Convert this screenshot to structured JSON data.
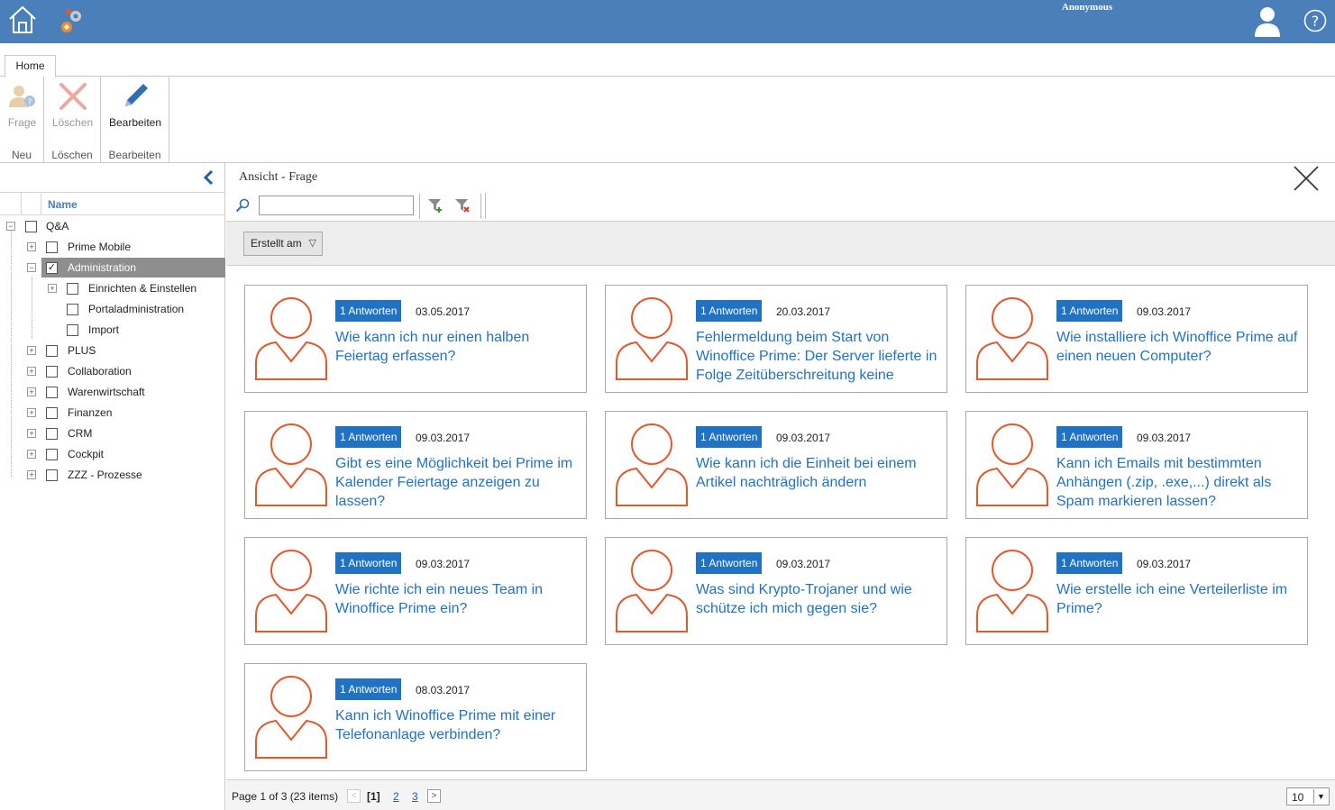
{
  "topbar": {
    "user_name": "Anonymous",
    "accent": "#4a7fba"
  },
  "ribbon": {
    "tab": "Home",
    "buttons": {
      "frage": "Frage",
      "loeschen": "Löschen",
      "bearbeiten": "Bearbeiten"
    },
    "groups": {
      "neu": "Neu",
      "loeschen": "Löschen",
      "bearbeiten": "Bearbeiten"
    }
  },
  "tree": {
    "header": "Name",
    "nodes": [
      {
        "label": "Q&A",
        "checked": false
      },
      {
        "label": "Prime Mobile",
        "checked": false
      },
      {
        "label": "Administration",
        "checked": true
      },
      {
        "label": "Einrichten & Einstellen",
        "checked": false
      },
      {
        "label": "Portaladministration",
        "checked": false
      },
      {
        "label": "Import",
        "checked": false
      },
      {
        "label": "PLUS",
        "checked": false
      },
      {
        "label": "Collaboration",
        "checked": false
      },
      {
        "label": "Warenwirtschaft",
        "checked": false
      },
      {
        "label": "Finanzen",
        "checked": false
      },
      {
        "label": "CRM",
        "checked": false
      },
      {
        "label": "Cockpit",
        "checked": false
      },
      {
        "label": "ZZZ - Prozesse",
        "checked": false
      }
    ]
  },
  "main": {
    "title": "Ansicht - Frage",
    "search": {
      "value": "",
      "placeholder": ""
    },
    "sort_button": "Erstellt am",
    "cards": [
      {
        "answers": "1 Antworten",
        "date": "03.05.2017",
        "question": "Wie kann ich nur einen halben Feiertag erfassen?"
      },
      {
        "answers": "1 Antworten",
        "date": "20.03.2017",
        "question": "Fehlermeldung beim Start von Winoffice Prime: Der Server lieferte in Folge Zeitüberschreitung keine"
      },
      {
        "answers": "1 Antworten",
        "date": "09.03.2017",
        "question": "Wie installiere ich Winoffice Prime auf einen neuen Computer?"
      },
      {
        "answers": "1 Antworten",
        "date": "09.03.2017",
        "question": "Gibt es eine Möglichkeit bei Prime im Kalender Feiertage anzeigen zu lassen?"
      },
      {
        "answers": "1 Antworten",
        "date": "09.03.2017",
        "question": "Wie kann ich die Einheit bei einem Artikel nachträglich ändern"
      },
      {
        "answers": "1 Antworten",
        "date": "09.03.2017",
        "question": "Kann ich Emails mit bestimmten Anhängen (.zip, .exe,...) direkt als Spam markieren lassen?"
      },
      {
        "answers": "1 Antworten",
        "date": "09.03.2017",
        "question": "Wie richte ich ein neues Team in Winoffice Prime ein?"
      },
      {
        "answers": "1 Antworten",
        "date": "09.03.2017",
        "question": "Was sind Krypto-Trojaner und wie schütze ich mich gegen sie?"
      },
      {
        "answers": "1 Antworten",
        "date": "09.03.2017",
        "question": "Wie erstelle ich eine Verteilerliste im Prime?"
      },
      {
        "answers": "1 Antworten",
        "date": "08.03.2017",
        "question": "Kann ich Winoffice Prime mit einer Telefonanlage verbinden?"
      }
    ],
    "pager": {
      "info": "Page 1 of 3 (23 items)",
      "current": "[1]",
      "page2": "2",
      "page3": "3",
      "page_size": "10"
    }
  },
  "colors": {
    "badge": "#1f73c2",
    "question": "#1f73c2",
    "avatar": "#e05a2b"
  }
}
